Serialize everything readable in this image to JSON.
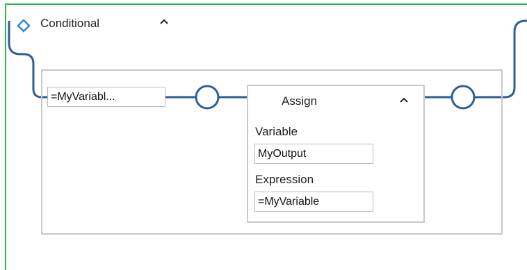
{
  "conditional": {
    "title": "Conditional",
    "condition_value": "=MyVariabl..."
  },
  "assign": {
    "title": "Assign",
    "variable_label": "Variable",
    "variable_value": "MyOutput",
    "expression_label": "Expression",
    "expression_value": "=MyVariable"
  },
  "icons": {
    "conditional": "diamond-icon",
    "collapse": "caret-up-icon",
    "connector": "circle-connector-icon"
  },
  "colors": {
    "frame": "#2db84a",
    "wire": "#2e5e99",
    "diamond": "#2b8ad6",
    "box_border": "#c9c9c9"
  }
}
